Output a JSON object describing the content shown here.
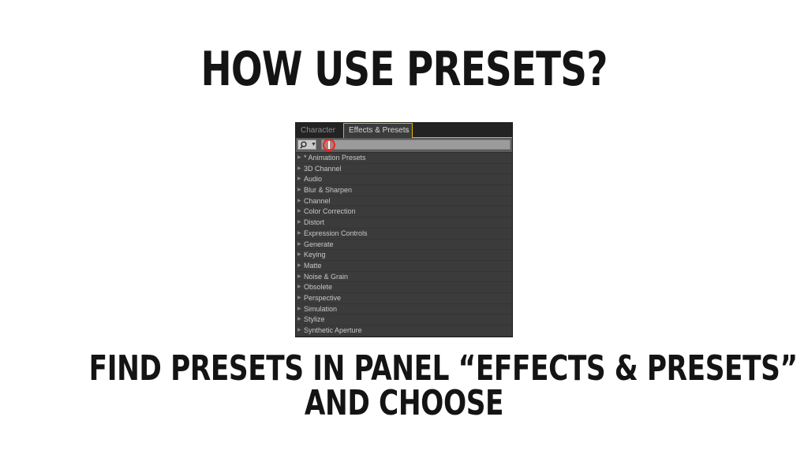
{
  "slide": {
    "title": "How use presets?",
    "caption_line1": "Find presets in panel “Effects & Presets”",
    "caption_line2": "and choose"
  },
  "panel": {
    "tabs": [
      {
        "label": "Character",
        "active": false
      },
      {
        "label": "Effects & Presets",
        "active": true,
        "close": "×"
      }
    ],
    "search": {
      "value": "",
      "placeholder": ""
    },
    "accent_color": "#e5b400",
    "highlight_color": "#e8261f",
    "items": [
      "* Animation Presets",
      "3D Channel",
      "Audio",
      "Blur & Sharpen",
      "Channel",
      "Color Correction",
      "Distort",
      "Expression Controls",
      "Generate",
      "Keying",
      "Matte",
      "Noise & Grain",
      "Obsolete",
      "Perspective",
      "Simulation",
      "Stylize",
      "Synthetic Aperture"
    ]
  },
  "icons": {
    "search": "magnifier-icon",
    "dropdown": "chevron-down-icon",
    "expand": "triangle-right-icon",
    "close": "close-icon"
  }
}
